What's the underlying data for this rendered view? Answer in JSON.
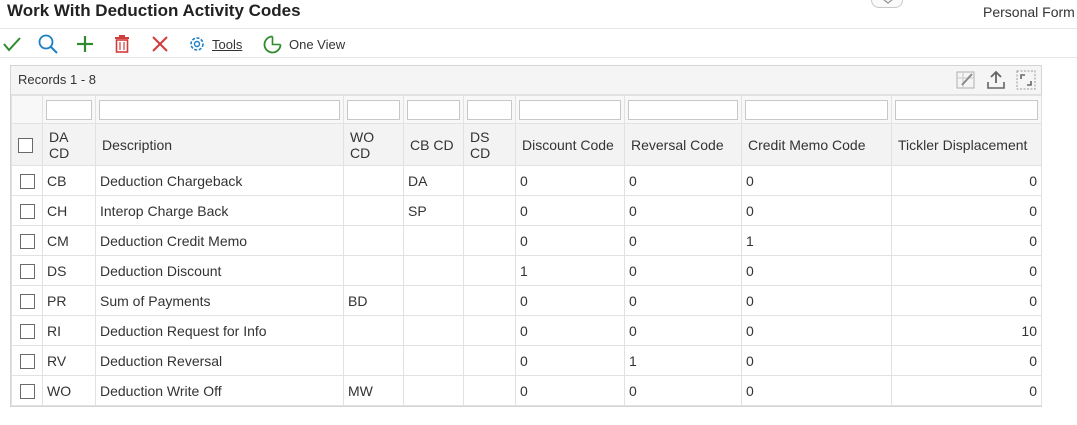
{
  "header": {
    "title": "Work With Deduction Activity Codes",
    "personal_form": "Personal Form"
  },
  "toolbar": {
    "select_icon": "checkmark-icon",
    "find_icon": "search-icon",
    "add_icon": "plus-icon",
    "delete_icon": "trash-icon",
    "close_icon": "close-icon",
    "tools_icon": "gear-icon",
    "tools_label": "Tools",
    "one_view_icon": "one-view-icon",
    "one_view_label": "One View"
  },
  "grid": {
    "records_label": "Records 1 - 8",
    "columns": [
      {
        "label": "DA CD"
      },
      {
        "label": "Description"
      },
      {
        "label": "WO CD"
      },
      {
        "label": "CB CD"
      },
      {
        "label": "DS CD"
      },
      {
        "label": "Discount Code"
      },
      {
        "label": "Reversal Code"
      },
      {
        "label": "Credit Memo Code"
      },
      {
        "label": "Tickler Displacement"
      }
    ],
    "rows": [
      {
        "da_cd": "CB",
        "description": "Deduction Chargeback",
        "wo_cd": "",
        "cb_cd": "DA",
        "ds_cd": "",
        "discount": "0",
        "reversal": "0",
        "credit_memo": "0",
        "tickler": "0"
      },
      {
        "da_cd": "CH",
        "description": "Interop Charge Back",
        "wo_cd": "",
        "cb_cd": "SP",
        "ds_cd": "",
        "discount": "0",
        "reversal": "0",
        "credit_memo": "0",
        "tickler": "0"
      },
      {
        "da_cd": "CM",
        "description": "Deduction Credit Memo",
        "wo_cd": "",
        "cb_cd": "",
        "ds_cd": "",
        "discount": "0",
        "reversal": "0",
        "credit_memo": "1",
        "tickler": "0"
      },
      {
        "da_cd": "DS",
        "description": "Deduction Discount",
        "wo_cd": "",
        "cb_cd": "",
        "ds_cd": "",
        "discount": "1",
        "reversal": "0",
        "credit_memo": "0",
        "tickler": "0"
      },
      {
        "da_cd": "PR",
        "description": "Sum of Payments",
        "wo_cd": "BD",
        "cb_cd": "",
        "ds_cd": "",
        "discount": "0",
        "reversal": "0",
        "credit_memo": "0",
        "tickler": "0"
      },
      {
        "da_cd": "RI",
        "description": "Deduction Request for Info",
        "wo_cd": "",
        "cb_cd": "",
        "ds_cd": "",
        "discount": "0",
        "reversal": "0",
        "credit_memo": "0",
        "tickler": "10"
      },
      {
        "da_cd": "RV",
        "description": "Deduction Reversal",
        "wo_cd": "",
        "cb_cd": "",
        "ds_cd": "",
        "discount": "0",
        "reversal": "1",
        "credit_memo": "0",
        "tickler": "0"
      },
      {
        "da_cd": "WO",
        "description": "Deduction Write Off",
        "wo_cd": "MW",
        "cb_cd": "",
        "ds_cd": "",
        "discount": "0",
        "reversal": "0",
        "credit_memo": "0",
        "tickler": "0"
      }
    ]
  }
}
